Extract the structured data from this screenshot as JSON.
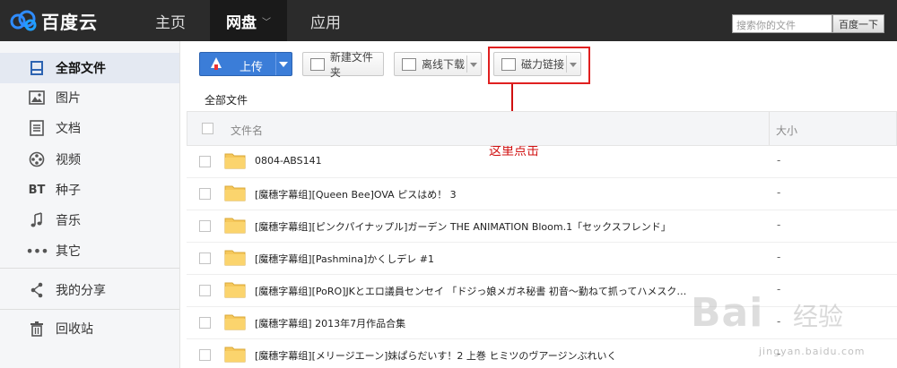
{
  "header": {
    "logo_text": "百度云",
    "nav": [
      "主页",
      "网盘",
      "应用"
    ],
    "search_placeholder": "搜索你的文件",
    "search_button": "百度一下"
  },
  "sidebar": {
    "items": [
      {
        "label": "全部文件",
        "icon": "document-icon"
      },
      {
        "label": "图片",
        "icon": "image-icon"
      },
      {
        "label": "文档",
        "icon": "list-icon"
      },
      {
        "label": "视频",
        "icon": "film-reel-icon"
      },
      {
        "label": "种子",
        "icon": "bt-icon",
        "icon_text": "BT"
      },
      {
        "label": "音乐",
        "icon": "music-note-icon"
      },
      {
        "label": "其它",
        "icon": "more-dots-icon"
      },
      {
        "label": "我的分享",
        "icon": "share-icon"
      },
      {
        "label": "回收站",
        "icon": "trash-icon"
      }
    ]
  },
  "toolbar": {
    "upload": "上传",
    "new_folder": "新建文件夹",
    "offline_download": "离线下载",
    "magnet_link": "磁力链接"
  },
  "annotation": "这里点击",
  "breadcrumb": "全部文件",
  "table": {
    "columns": [
      "文件名",
      "大小"
    ],
    "rows": [
      {
        "name": "0804-ABS141",
        "size": "-"
      },
      {
        "name": "[魔穗字幕组][Queen Bee]OVA ピスはめ！ 3",
        "size": "-"
      },
      {
        "name": "[魔穗字幕组][ピンクパイナップル]ガーデン THE ANIMATION Bloom.1「セックスフレンド」",
        "size": "-"
      },
      {
        "name": "[魔穗字幕组][Pashmina]かくしデレ #1",
        "size": "-"
      },
      {
        "name": "[魔穗字幕组][PoRO]JKとエロ議員センセイ 「ドジっ娘メガネ秘書 初音～勤ねて抓ってハメスク…",
        "size": "-"
      },
      {
        "name": "[魔穗字幕组] 2013年7月作品合集",
        "size": "-"
      },
      {
        "name": "[魔穗字幕组][メリージエーン]妹ぱらだいす！2 上巻 ヒミツのヴアージンぶれいく",
        "size": "-"
      }
    ]
  },
  "watermark": {
    "brand": "Bai",
    "text": "经验",
    "url": "jingyan.baidu.com"
  },
  "colors": {
    "topbar": "#2b2b2b",
    "accent": "#3b7dd8",
    "annotation": "#d01010"
  }
}
